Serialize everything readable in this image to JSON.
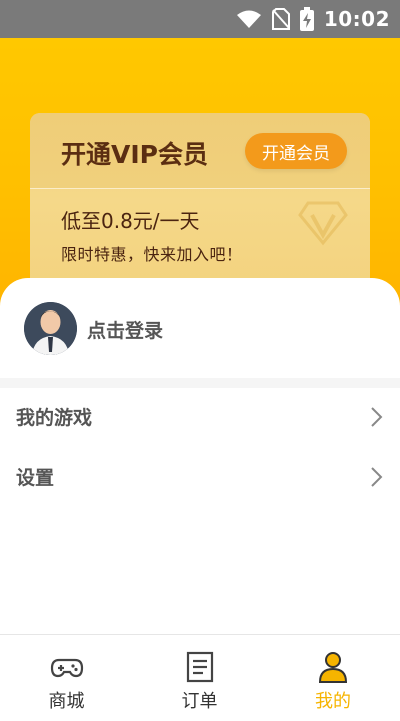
{
  "statusbar": {
    "time": "10:02",
    "icons": [
      "wifi-icon",
      "no-sim-icon",
      "battery-charging-icon"
    ]
  },
  "vip_card": {
    "title": "开通VIP会员",
    "open_button": "开通会员",
    "price_text": "低至0.8元/一天",
    "promo_text": "限时特惠，快来加入吧！",
    "decor_icon": "diamond-icon",
    "colors": {
      "button": "#f39a1b",
      "title": "#5b2e12",
      "card": "#f3d37f"
    }
  },
  "user": {
    "login_text": "点击登录",
    "avatar_icon": "user-avatar-icon"
  },
  "menu": {
    "items": [
      {
        "label": "我的游戏",
        "icon": "chevron-right-icon"
      },
      {
        "label": "设置",
        "icon": "chevron-right-icon"
      }
    ]
  },
  "tabbar": {
    "tabs": [
      {
        "label": "商城",
        "icon": "gamepad-icon",
        "active": false
      },
      {
        "label": "订单",
        "icon": "order-list-icon",
        "active": false
      },
      {
        "label": "我的",
        "icon": "person-icon",
        "active": true
      }
    ],
    "active_color": "#f6b400"
  },
  "theme": {
    "header": "#ffc200",
    "statusbar": "#7a7a7a"
  }
}
